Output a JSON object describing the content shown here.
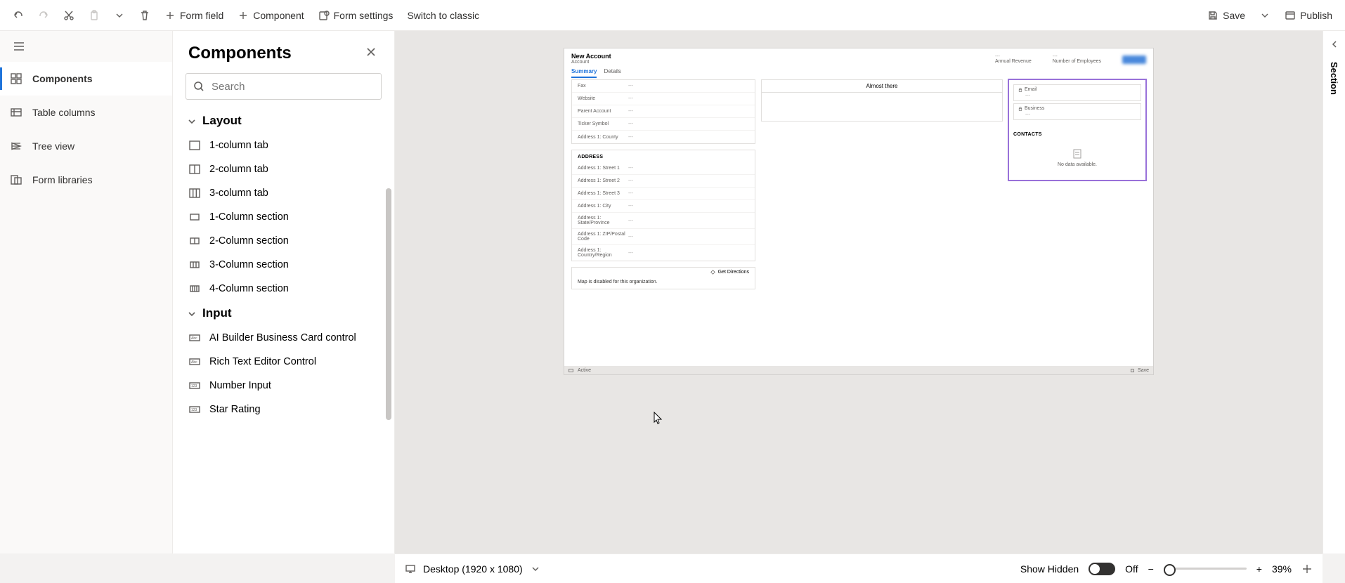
{
  "commandbar": {
    "formField": "Form field",
    "component": "Component",
    "formSettings": "Form settings",
    "switch": "Switch to classic",
    "save": "Save",
    "publish": "Publish"
  },
  "leftNav": {
    "components": "Components",
    "tableColumns": "Table columns",
    "treeView": "Tree view",
    "formLibraries": "Form libraries"
  },
  "componentsPanel": {
    "title": "Components",
    "searchPlaceholder": "Search",
    "groups": {
      "layout": "Layout",
      "input": "Input"
    },
    "layoutItems": {
      "col1tab": "1-column tab",
      "col2tab": "2-column tab",
      "col3tab": "3-column tab",
      "col1sec": "1-Column section",
      "col2sec": "2-Column section",
      "col3sec": "3-Column section",
      "col4sec": "4-Column section"
    },
    "inputItems": {
      "aiBuilder": "AI Builder Business Card control",
      "richText": "Rich Text Editor Control",
      "numberInput": "Number Input",
      "starRating": "Star Rating"
    }
  },
  "form": {
    "title": "New Account",
    "entity": "Account",
    "headerFields": {
      "annualRevenue": "Annual Revenue",
      "numEmployees": "Number of Employees"
    },
    "tabs": {
      "summary": "Summary",
      "details": "Details"
    },
    "timeline": {
      "almost": "Almost there"
    },
    "fields": {
      "blank": "---",
      "fax": "Fax",
      "website": "Website",
      "parentAccount": "Parent Account",
      "ticker": "Ticker Symbol",
      "addr1county": "Address 1: County"
    },
    "addressTitle": "ADDRESS",
    "addressFields": {
      "street1": "Address 1: Street 1",
      "street2": "Address 1: Street 2",
      "street3": "Address 1: Street 3",
      "city": "Address 1: City",
      "state": "Address 1: State/Province",
      "zip": "Address 1: ZIP/Postal Code",
      "country": "Address 1: Country/Region"
    },
    "getDirections": "Get Directions",
    "mapMsg": "Map is disabled for this organization.",
    "right": {
      "email": "Email",
      "business": "Business",
      "contacts": "CONTACTS",
      "noData": "No data available."
    },
    "footer": {
      "status": "Active",
      "save": "Save"
    }
  },
  "rightPane": {
    "section": "Section"
  },
  "statusbar": {
    "viewport": "Desktop (1920 x 1080)",
    "showHidden": "Show Hidden",
    "toggle": "Off",
    "zoom": "39%"
  }
}
